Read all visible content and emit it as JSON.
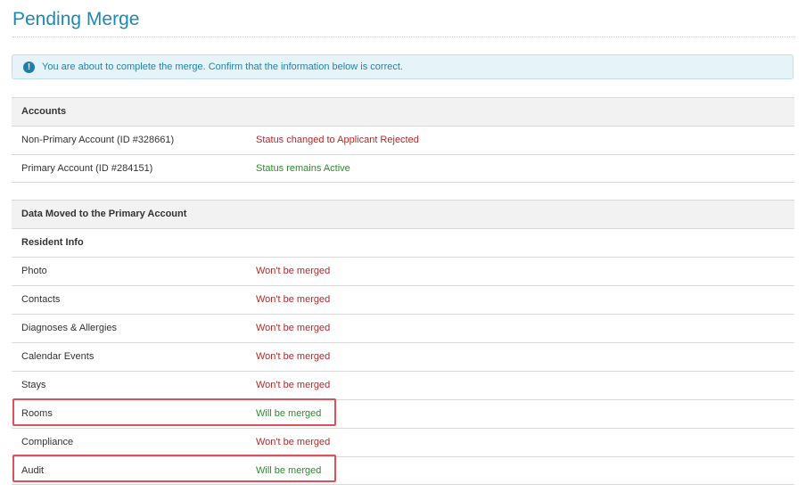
{
  "page": {
    "title": "Pending Merge"
  },
  "alert": {
    "icon": "exclamation-circle-icon",
    "text": "You are about to complete the merge. Confirm that the information below is correct."
  },
  "accounts": {
    "header": "Accounts",
    "rows": [
      {
        "label": "Non-Primary Account (ID #328661)",
        "status": "Status changed to Applicant Rejected",
        "tone": "red"
      },
      {
        "label": "Primary Account (ID #284151)",
        "status": "Status remains Active",
        "tone": "green"
      }
    ]
  },
  "data_moved": {
    "header": "Data Moved to the Primary Account",
    "subheader": "Resident Info",
    "rows": [
      {
        "label": "Photo",
        "status": "Won't be merged",
        "tone": "red"
      },
      {
        "label": "Contacts",
        "status": "Won't be merged",
        "tone": "red"
      },
      {
        "label": "Diagnoses & Allergies",
        "status": "Won't be merged",
        "tone": "red"
      },
      {
        "label": "Calendar Events",
        "status": "Won't be merged",
        "tone": "red"
      },
      {
        "label": "Stays",
        "status": "Won't be merged",
        "tone": "red"
      },
      {
        "label": "Rooms",
        "status": "Will be merged",
        "tone": "green"
      },
      {
        "label": "Compliance",
        "status": "Won't be merged",
        "tone": "red"
      },
      {
        "label": "Audit",
        "status": "Will be merged",
        "tone": "green"
      }
    ]
  },
  "colors": {
    "accent": "#1d89b5",
    "status_red": "#b52a2a",
    "status_green": "#2e8b2e",
    "highlight": "#e0505a"
  }
}
